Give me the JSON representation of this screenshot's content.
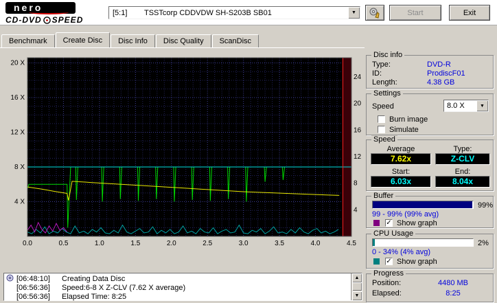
{
  "topbar": {
    "logo": {
      "brand": "nero",
      "line2_left": "CD-DVD",
      "line2_right": "SPEED"
    },
    "device_select": {
      "prefix": "[5:1]",
      "name": "TSSTcorp CDDVDW SH-S203B SB01"
    },
    "start_label": "Start",
    "start_disabled": true,
    "exit_label": "Exit"
  },
  "tabs": [
    {
      "label": "Benchmark",
      "active": false
    },
    {
      "label": "Create Disc",
      "active": true
    },
    {
      "label": "Disc Info",
      "active": false
    },
    {
      "label": "Disc Quality",
      "active": false
    },
    {
      "label": "ScanDisc",
      "active": false
    }
  ],
  "chart_data": {
    "type": "line",
    "x_axis": {
      "range": [
        0,
        4.5
      ],
      "tick_values": [
        0,
        0.5,
        1,
        1.5,
        2,
        2.5,
        3,
        3.5,
        4,
        4.5
      ],
      "ticks": [
        "0.0",
        "0.5",
        "1.0",
        "1.5",
        "2.0",
        "2.5",
        "3.0",
        "3.5",
        "4.0",
        "4.5"
      ],
      "unit": "GB"
    },
    "y_left": {
      "range": [
        0,
        20.6
      ],
      "ticks": [
        4,
        8,
        12,
        16,
        20
      ],
      "suffix": " X"
    },
    "y_right": {
      "range": [
        0,
        26.9
      ],
      "ticks": [
        4,
        8,
        12,
        16,
        20,
        24
      ]
    },
    "bg": "#000000",
    "grid": {
      "x_step": 0.1,
      "y_step": 1,
      "minor_color": "#23235c",
      "major_color": "#3d3d94"
    },
    "position_marker": {
      "x": 4.38,
      "line_color": "#ff2020",
      "band_color": "#3a0008"
    },
    "series": [
      {
        "name": "cpu-usage",
        "color": "#00a0a0",
        "x0": 0,
        "dx": 0.06,
        "values": [
          0.5,
          0.3,
          0.8,
          0.4,
          1.1,
          0.3,
          0.6,
          0.4,
          0.9,
          0.5,
          0.3,
          1.2,
          0.4,
          0.6,
          0.3,
          0.8,
          0.5,
          1.0,
          0.4,
          0.3,
          0.7,
          0.4,
          1.3,
          0.5,
          0.3,
          0.6,
          0.9,
          0.4,
          0.5,
          1.1,
          0.3,
          0.7,
          0.4,
          0.8,
          0.3,
          0.5,
          1.2,
          0.4,
          0.6,
          0.3,
          0.9,
          0.5,
          0.4,
          1.0,
          0.3,
          0.6,
          0.8,
          0.4,
          0.5,
          1.3,
          0.4,
          0.3,
          0.7,
          0.5,
          0.9,
          0.3,
          0.6,
          1.1,
          0.4,
          0.5,
          0.3,
          0.8,
          0.4,
          1.0,
          0.5,
          0.3,
          0.7,
          0.9,
          0.4,
          0.6,
          0.3,
          0.5,
          0.8
        ]
      },
      {
        "name": "buffer-early",
        "color": "#b818b8",
        "x0": 0,
        "dx": 0.05,
        "values": [
          0.7,
          1.3,
          0.5,
          1.6,
          0.8,
          0.4,
          1.2,
          0.6,
          1.5,
          0.7,
          1.0,
          0.5
        ]
      },
      {
        "name": "write-speed",
        "color": "#00d800",
        "points": [
          [
            0,
            5.5
          ],
          [
            0.02,
            6
          ],
          [
            0.55,
            6
          ],
          [
            0.56,
            1
          ],
          [
            0.6,
            8
          ],
          [
            0.67,
            8
          ],
          [
            0.68,
            4.2
          ],
          [
            0.7,
            8
          ],
          [
            1.03,
            8
          ],
          [
            1.04,
            4
          ],
          [
            1.06,
            8
          ],
          [
            1.28,
            8
          ],
          [
            1.29,
            4.3
          ],
          [
            1.31,
            8
          ],
          [
            1.53,
            8
          ],
          [
            1.54,
            4.1
          ],
          [
            1.56,
            8
          ],
          [
            1.78,
            8
          ],
          [
            1.79,
            4.3
          ],
          [
            1.81,
            8
          ],
          [
            2.03,
            8
          ],
          [
            2.04,
            4
          ],
          [
            2.06,
            8
          ],
          [
            2.28,
            8
          ],
          [
            2.29,
            4.2
          ],
          [
            2.31,
            8
          ],
          [
            2.53,
            8
          ],
          [
            2.54,
            4.1
          ],
          [
            2.56,
            8
          ],
          [
            2.78,
            8
          ],
          [
            2.79,
            4.3
          ],
          [
            2.81,
            8
          ],
          [
            3.03,
            8
          ],
          [
            3.04,
            4
          ],
          [
            3.06,
            8
          ],
          [
            3.29,
            8
          ],
          [
            3.3,
            6.3
          ],
          [
            3.32,
            8
          ],
          [
            3.54,
            8
          ],
          [
            3.55,
            6.5
          ],
          [
            3.57,
            8
          ],
          [
            4.33,
            8
          ]
        ]
      },
      {
        "name": "buffer-level",
        "color": "#00e0e0",
        "points": [
          [
            0,
            8
          ],
          [
            4.5,
            8
          ]
        ]
      },
      {
        "name": "spindle-speed",
        "color": "#e8e800",
        "points": [
          [
            0,
            5.7
          ],
          [
            0.2,
            5.45
          ],
          [
            0.4,
            5.15
          ],
          [
            0.55,
            4.95
          ],
          [
            0.57,
            4.15
          ],
          [
            0.62,
            6.35
          ],
          [
            0.9,
            6.2
          ],
          [
            1.2,
            6.05
          ],
          [
            1.5,
            5.9
          ],
          [
            1.8,
            5.75
          ],
          [
            2.1,
            5.6
          ],
          [
            2.4,
            5.45
          ],
          [
            2.7,
            5.3
          ],
          [
            3.0,
            5.15
          ],
          [
            3.3,
            5.05
          ],
          [
            3.6,
            4.95
          ],
          [
            3.9,
            4.85
          ],
          [
            4.15,
            4.78
          ],
          [
            4.33,
            4.72
          ]
        ]
      }
    ]
  },
  "log": {
    "entries": [
      {
        "time": "[06:48:10]",
        "text": "Creating Data Disc"
      },
      {
        "time": "[06:56:36]",
        "text": "Speed:6-8 X Z-CLV (7.62 X average)"
      },
      {
        "time": "[06:56:36]",
        "text": "Elapsed Time: 8:25"
      }
    ]
  },
  "sidebar": {
    "disc_info": {
      "title": "Disc info",
      "rows": [
        [
          "Type:",
          "DVD-R"
        ],
        [
          "ID:",
          "ProdiscF01"
        ],
        [
          "Length:",
          "4.38 GB"
        ]
      ]
    },
    "settings": {
      "title": "Settings",
      "speed_label": "Speed",
      "speed_value": "8.0 X",
      "checkboxes": [
        {
          "label": "Burn image",
          "checked": false
        },
        {
          "label": "Simulate",
          "checked": false
        }
      ]
    },
    "speed": {
      "title": "Speed",
      "average_label": "Average",
      "average_value": "7.62x",
      "average_color": "#ffff00",
      "type_label": "Type:",
      "type_value": "Z-CLV",
      "start_label": "Start:",
      "start_value": "6.03x",
      "end_label": "End:",
      "end_value": "8.04x",
      "value_color": "#00ffff"
    },
    "buffer": {
      "title": "Buffer",
      "percent_value": 99,
      "percent_text": "99%",
      "bar_color": "#000080",
      "range_text": "99 - 99% (99% avg)",
      "legend_color": "#800080",
      "show_graph_label": "Show graph",
      "show_graph_checked": true
    },
    "cpu": {
      "title": "CPU Usage",
      "percent_value": 2,
      "percent_text": "2%",
      "bar_color": "#008080",
      "range_text": "0 - 34% (4% avg)",
      "legend_color": "#008080",
      "show_graph_label": "Show graph",
      "show_graph_checked": true
    },
    "progress": {
      "title": "Progress",
      "position_label": "Position:",
      "position_value": "4480 MB",
      "elapsed_label": "Elapsed:",
      "elapsed_value": "8:25"
    }
  },
  "colors": {
    "window_bg": "#d4d0c8",
    "value_text": "#0000dd",
    "chart_bg": "#000000"
  }
}
